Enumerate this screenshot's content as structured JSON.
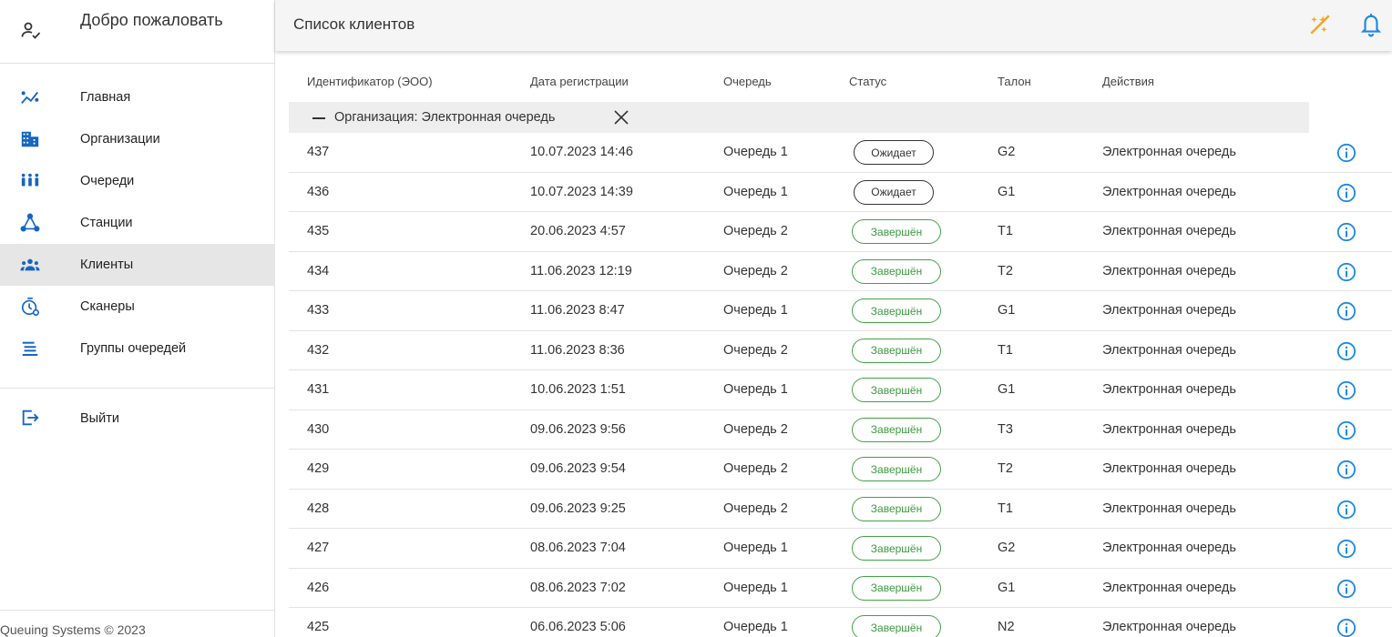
{
  "sidebar": {
    "welcome": "Добро пожаловать",
    "items": [
      {
        "label": "Главная",
        "icon": "chart-line-icon"
      },
      {
        "label": "Организации",
        "icon": "building-icon"
      },
      {
        "label": "Очереди",
        "icon": "people-queue-icon"
      },
      {
        "label": "Станции",
        "icon": "hub-icon"
      },
      {
        "label": "Клиенты",
        "icon": "clients-icon",
        "active": true
      },
      {
        "label": "Сканеры",
        "icon": "timer-icon"
      },
      {
        "label": "Группы очередей",
        "icon": "list-icon"
      }
    ],
    "logout": "Выйти",
    "footer": "Queuing Systems © 2023"
  },
  "topbar": {
    "title": "Список клиентов",
    "accent": "#f5a623",
    "icons": [
      "magic-off-icon",
      "bell-icon"
    ]
  },
  "table": {
    "headers": [
      "Идентификатор (ЭОО)",
      "Дата регистрации",
      "Очередь",
      "Статус",
      "Талон",
      "Действия"
    ],
    "group_label": "Организация: Электронная очередь",
    "rows": [
      {
        "id": "437",
        "date": "10.07.2023 14:46",
        "queue": "Очередь 1",
        "status": "Ожидает",
        "ticket": "G2",
        "org": "Электронная очередь"
      },
      {
        "id": "436",
        "date": "10.07.2023 14:39",
        "queue": "Очередь 1",
        "status": "Ожидает",
        "ticket": "G1",
        "org": "Электронная очередь"
      },
      {
        "id": "435",
        "date": "20.06.2023 4:57",
        "queue": "Очередь 2",
        "status": "Завершён",
        "ticket": "T1",
        "org": "Электронная очередь"
      },
      {
        "id": "434",
        "date": "11.06.2023 12:19",
        "queue": "Очередь 2",
        "status": "Завершён",
        "ticket": "T2",
        "org": "Электронная очередь"
      },
      {
        "id": "433",
        "date": "11.06.2023 8:47",
        "queue": "Очередь 1",
        "status": "Завершён",
        "ticket": "G1",
        "org": "Электронная очередь"
      },
      {
        "id": "432",
        "date": "11.06.2023 8:36",
        "queue": "Очередь 2",
        "status": "Завершён",
        "ticket": "T1",
        "org": "Электронная очередь"
      },
      {
        "id": "431",
        "date": "10.06.2023 1:51",
        "queue": "Очередь 1",
        "status": "Завершён",
        "ticket": "G1",
        "org": "Электронная очередь"
      },
      {
        "id": "430",
        "date": "09.06.2023 9:56",
        "queue": "Очередь 2",
        "status": "Завершён",
        "ticket": "T3",
        "org": "Электронная очередь"
      },
      {
        "id": "429",
        "date": "09.06.2023 9:54",
        "queue": "Очередь 2",
        "status": "Завершён",
        "ticket": "T2",
        "org": "Электронная очередь"
      },
      {
        "id": "428",
        "date": "09.06.2023 9:25",
        "queue": "Очередь 2",
        "status": "Завершён",
        "ticket": "T1",
        "org": "Электронная очередь"
      },
      {
        "id": "427",
        "date": "08.06.2023 7:04",
        "queue": "Очередь 1",
        "status": "Завершён",
        "ticket": "G2",
        "org": "Электронная очередь"
      },
      {
        "id": "426",
        "date": "08.06.2023 7:02",
        "queue": "Очередь 1",
        "status": "Завершён",
        "ticket": "G1",
        "org": "Электронная очередь"
      },
      {
        "id": "425",
        "date": "06.06.2023 5:06",
        "queue": "Очередь 1",
        "status": "Завершён",
        "ticket": "N2",
        "org": "Электронная очередь"
      }
    ]
  },
  "colors": {
    "info": "#1e88e5",
    "done": "#43a047"
  }
}
